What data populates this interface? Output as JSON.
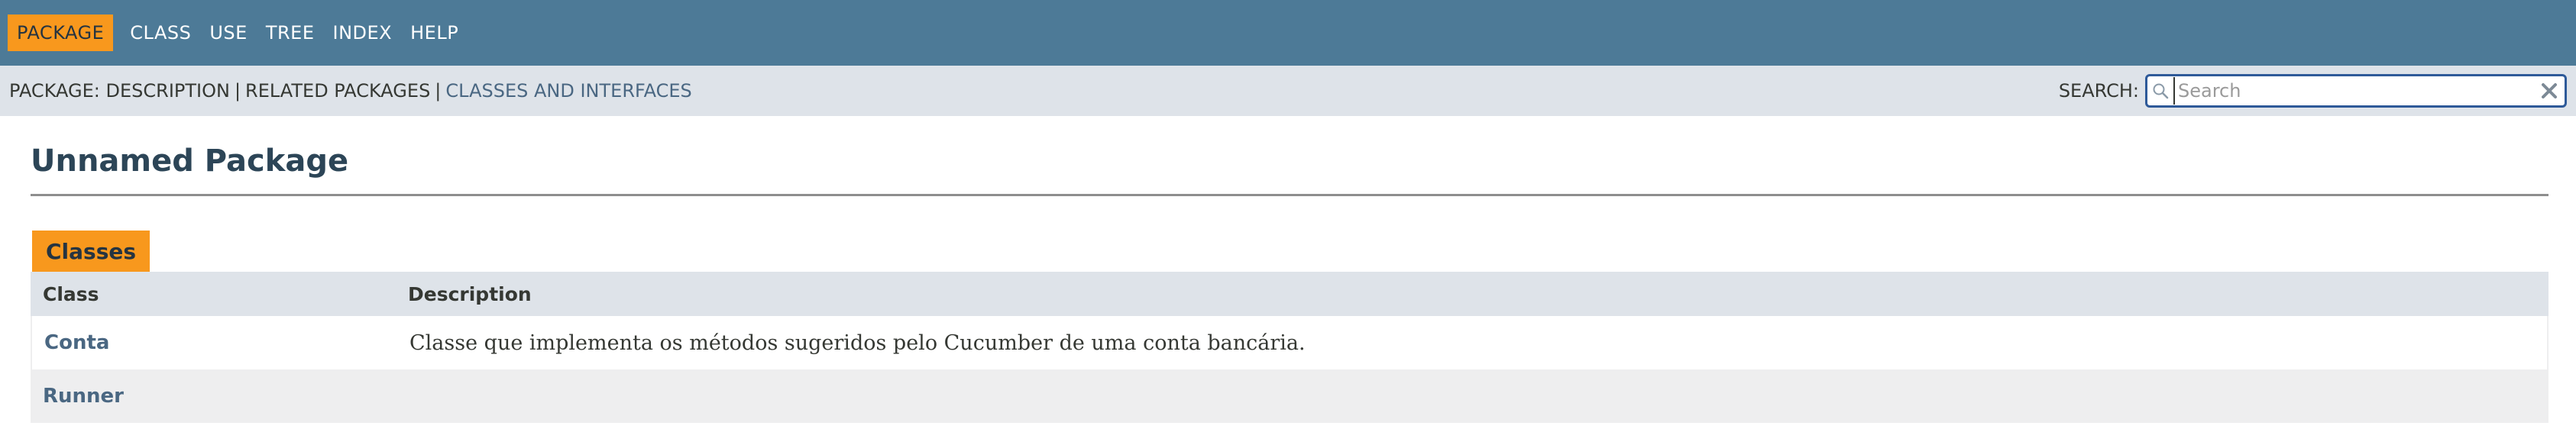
{
  "topnav": {
    "items": [
      {
        "label": "PACKAGE",
        "active": true
      },
      {
        "label": "CLASS",
        "active": false
      },
      {
        "label": "USE",
        "active": false
      },
      {
        "label": "TREE",
        "active": false
      },
      {
        "label": "INDEX",
        "active": false
      },
      {
        "label": "HELP",
        "active": false
      }
    ]
  },
  "subnav": {
    "package_label": "PACKAGE:",
    "description": "DESCRIPTION",
    "separator": "|",
    "related": "RELATED PACKAGES",
    "classes_link": "CLASSES AND INTERFACES",
    "search_label": "SEARCH:",
    "search_placeholder": "Search",
    "search_value": ""
  },
  "main": {
    "title": "Unnamed Package",
    "tab_label": "Classes",
    "columns": [
      "Class",
      "Description"
    ],
    "rows": [
      {
        "class": "Conta",
        "description": "Classe que implementa os métodos sugeridos pelo Cucumber de uma conta bancária."
      },
      {
        "class": "Runner",
        "description": ""
      }
    ]
  },
  "icons": {
    "search": "magnifier-icon",
    "reset": "close-x-icon"
  },
  "colors": {
    "nav_bg": "#4d7a97",
    "active_tab": "#f8981d",
    "subnav_bg": "#dee3e9",
    "link": "#4a6782"
  }
}
